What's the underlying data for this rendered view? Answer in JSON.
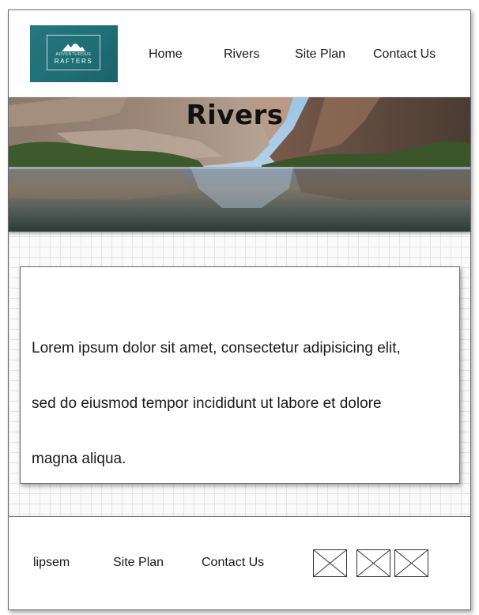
{
  "logo": {
    "small_text": "ADVENTUROUS",
    "big_text": "RAFTERS"
  },
  "nav": {
    "items": [
      {
        "label": "Home"
      },
      {
        "label": "Rivers"
      },
      {
        "label": "Site Plan"
      },
      {
        "label": "Contact Us"
      }
    ]
  },
  "hero": {
    "title": "Rivers"
  },
  "content": {
    "lines": [
      "Lorem ipsum dolor sit amet, consectetur adipisicing elit,",
      "sed do eiusmod tempor incididunt ut labore et dolore",
      "magna aliqua."
    ]
  },
  "footer": {
    "links": [
      {
        "label": "lipsem"
      },
      {
        "label": "Site Plan"
      },
      {
        "label": "Contact Us"
      }
    ],
    "social_icons": [
      "image-placeholder-icon",
      "image-placeholder-icon",
      "image-placeholder-icon"
    ]
  },
  "colors": {
    "logo_bg": "#1f6d75",
    "grid_line": "#e4e4e4",
    "border": "#6b6b6b"
  }
}
